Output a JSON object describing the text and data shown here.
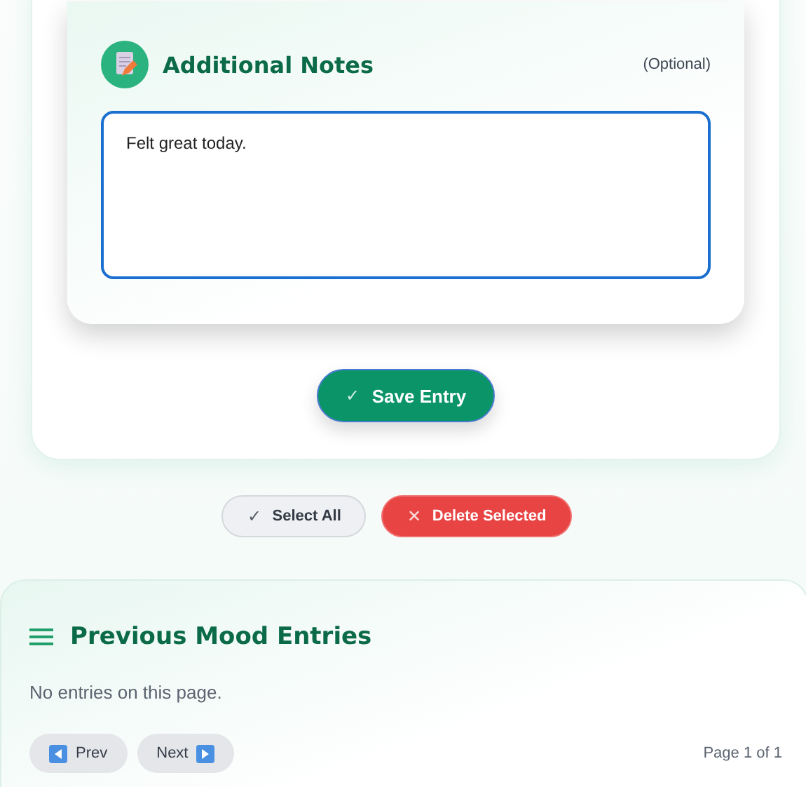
{
  "notes_card": {
    "title": "Additional Notes",
    "optional_label": "(Optional)",
    "textarea": {
      "value": "Felt great today."
    }
  },
  "save_button": {
    "icon": "✓",
    "label": "Save Entry"
  },
  "bulk_actions": [
    {
      "kind": "neutral",
      "icon": "✓",
      "label": "Select All"
    },
    {
      "kind": "danger",
      "icon": "✕",
      "label": "Delete Selected"
    }
  ],
  "entries_section": {
    "title": "Previous Mood Entries",
    "empty_message": "No entries on this page.",
    "pagination": {
      "prev": "Prev",
      "next": "Next",
      "page_info": "Page 1 of 1"
    }
  }
}
